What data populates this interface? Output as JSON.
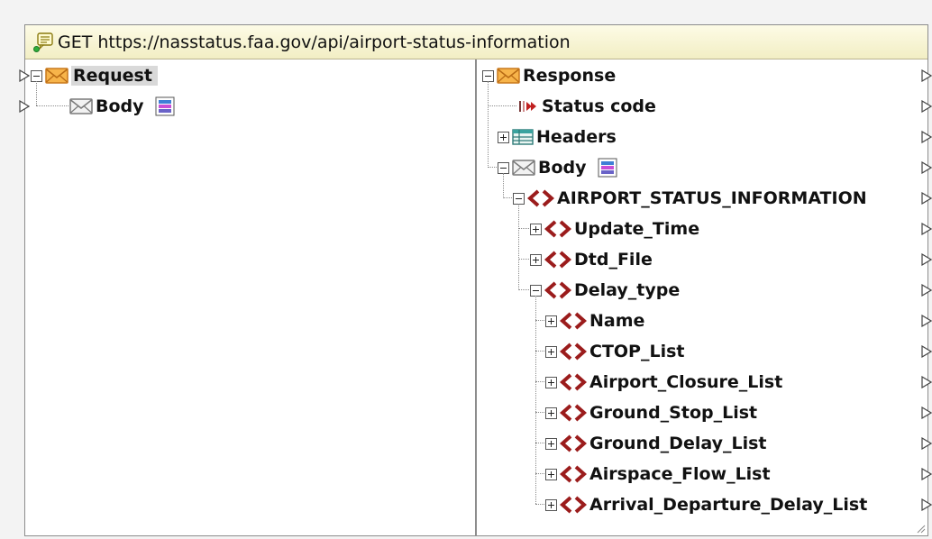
{
  "component": {
    "title": "GET https://nasstatus.faa.gov/api/airport-status-information",
    "icon": "web-service-call-icon"
  },
  "request": {
    "root_label": "Request",
    "children": [
      {
        "label": "Body"
      }
    ]
  },
  "response": {
    "root_label": "Response",
    "status_code_label": "Status code",
    "headers_label": "Headers",
    "body_label": "Body",
    "root_element": "AIRPORT_STATUS_INFORMATION",
    "elements": [
      "Update_Time",
      "Dtd_File",
      "Delay_type"
    ],
    "delay_type_children": [
      "Name",
      "CTOP_List",
      "Airport_Closure_List",
      "Ground_Stop_List",
      "Ground_Delay_List",
      "Airspace_Flow_List",
      "Arrival_Departure_Delay_List"
    ]
  },
  "colors": {
    "element_brackets": "#9b1c1c",
    "title_bar_top": "#fdfbe6",
    "title_bar_bottom": "#f2eec4",
    "envelope": "#f4a93a",
    "selected_row": "#d9d9d9"
  }
}
